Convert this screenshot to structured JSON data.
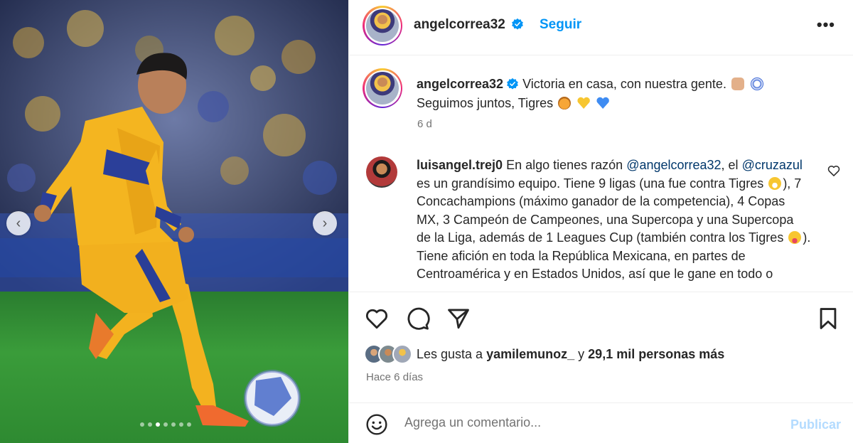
{
  "media": {
    "prev_arrow": "‹",
    "next_arrow": "›",
    "slides_total": 7,
    "slide_active": 3
  },
  "header": {
    "username": "angelcorrea32",
    "follow_label": "Seguir",
    "more_label": "•••"
  },
  "caption": {
    "username": "angelcorrea32",
    "text_line1": "Victoria en casa, con nuestra gente.",
    "text_line2": "Seguimos juntos, Tigres",
    "time": "6 d"
  },
  "comment": {
    "username": "luisangel.trej0",
    "text_a": "En algo tienes razón",
    "mention_1": "@angelcorrea32",
    "text_b": ", el",
    "mention_2": "@cruzazul",
    "text_c": "es un grandísimo equipo. Tiene 9 ligas (una fue contra Tigres",
    "text_d": "), 7 Concachampions (máximo ganador de la competencia), 4 Copas MX, 3 Campeón de Campeones, una Supercopa y una Supercopa de la Liga, además de 1 Leagues Cup (también contra los Tigres",
    "text_e": ").",
    "text_f": "Tiene afición en toda la República Mexicana, en partes de Centroamérica y en Estados Unidos, así que le gane en todo o"
  },
  "likes": {
    "prefix": "Les gusta a",
    "user": "yamilemunoz_",
    "middle": "y",
    "count_text": "29,1 mil personas más",
    "posted": "Hace 6 días"
  },
  "add_comment": {
    "placeholder": "Agrega un comentario...",
    "publish_label": "Publicar"
  },
  "colors": {
    "accent": "#0095f6",
    "publish_disabled": "#b3dbff",
    "muted": "#737373",
    "mention": "#00376b"
  },
  "icons": [
    "verified-badge-icon",
    "heart-icon",
    "comment-icon",
    "share-icon",
    "bookmark-icon",
    "emoji-icon",
    "more-icon"
  ]
}
